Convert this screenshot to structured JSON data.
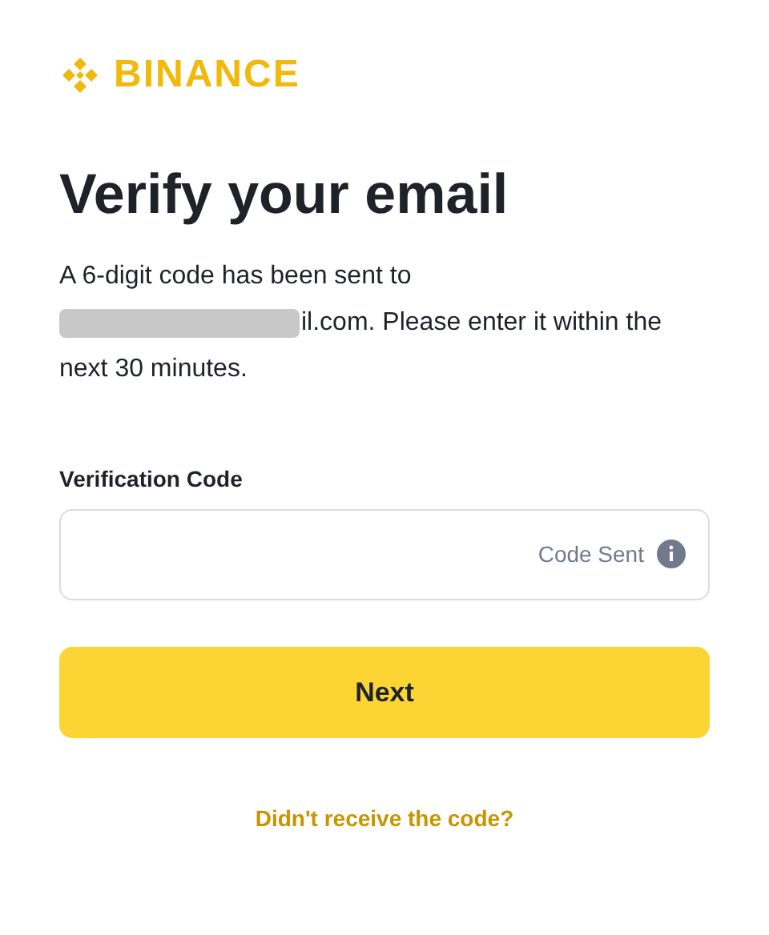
{
  "logo": {
    "text": "BINANCE"
  },
  "title": "Verify your email",
  "message": {
    "before": "A 6-digit code has been sent to",
    "redacted": true,
    "after": "il.com. Please enter it within the next 30 minutes."
  },
  "field": {
    "label": "Verification Code",
    "status": "Code Sent"
  },
  "button": {
    "label": "Next"
  },
  "link": "Didn't receive the code?"
}
